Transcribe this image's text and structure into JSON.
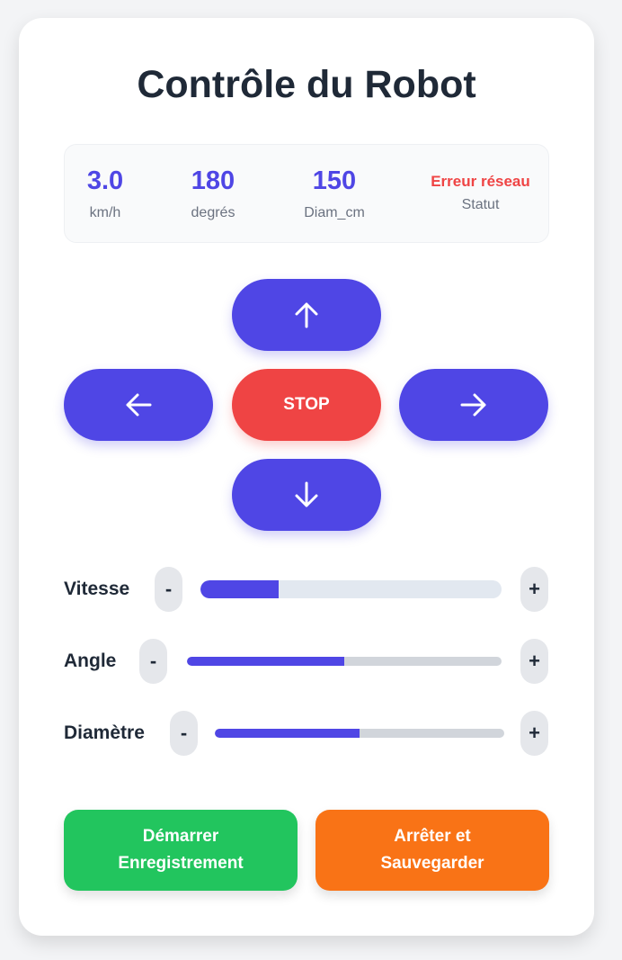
{
  "title": "Contrôle du Robot",
  "stats": [
    {
      "value": "3.0",
      "label": "km/h"
    },
    {
      "value": "180",
      "label": "degrés"
    },
    {
      "value": "150",
      "label": "Diam_cm"
    },
    {
      "value": "Erreur réseau",
      "label": "Statut"
    }
  ],
  "controls": {
    "up_icon": "arrow-up-icon",
    "down_icon": "arrow-down-icon",
    "left_icon": "arrow-left-icon",
    "right_icon": "arrow-right-icon",
    "stop_label": "STOP"
  },
  "sliders": [
    {
      "label": "Vitesse",
      "minus": "-",
      "plus": "+",
      "fill_percent": 26
    },
    {
      "label": "Angle",
      "minus": "-",
      "plus": "+",
      "fill_percent": 50
    },
    {
      "label": "Diamètre",
      "minus": "-",
      "plus": "+",
      "fill_percent": 50
    }
  ],
  "actions": {
    "start_line1": "Démarrer",
    "start_line2": "Enregistrement",
    "stop_line1": "Arrêter et",
    "stop_line2": "Sauvegarder"
  },
  "colors": {
    "accent": "#4f46e5",
    "stop": "#ef4444",
    "error_text": "#ef4444",
    "start_button": "#22c55e",
    "save_button": "#f97316"
  }
}
